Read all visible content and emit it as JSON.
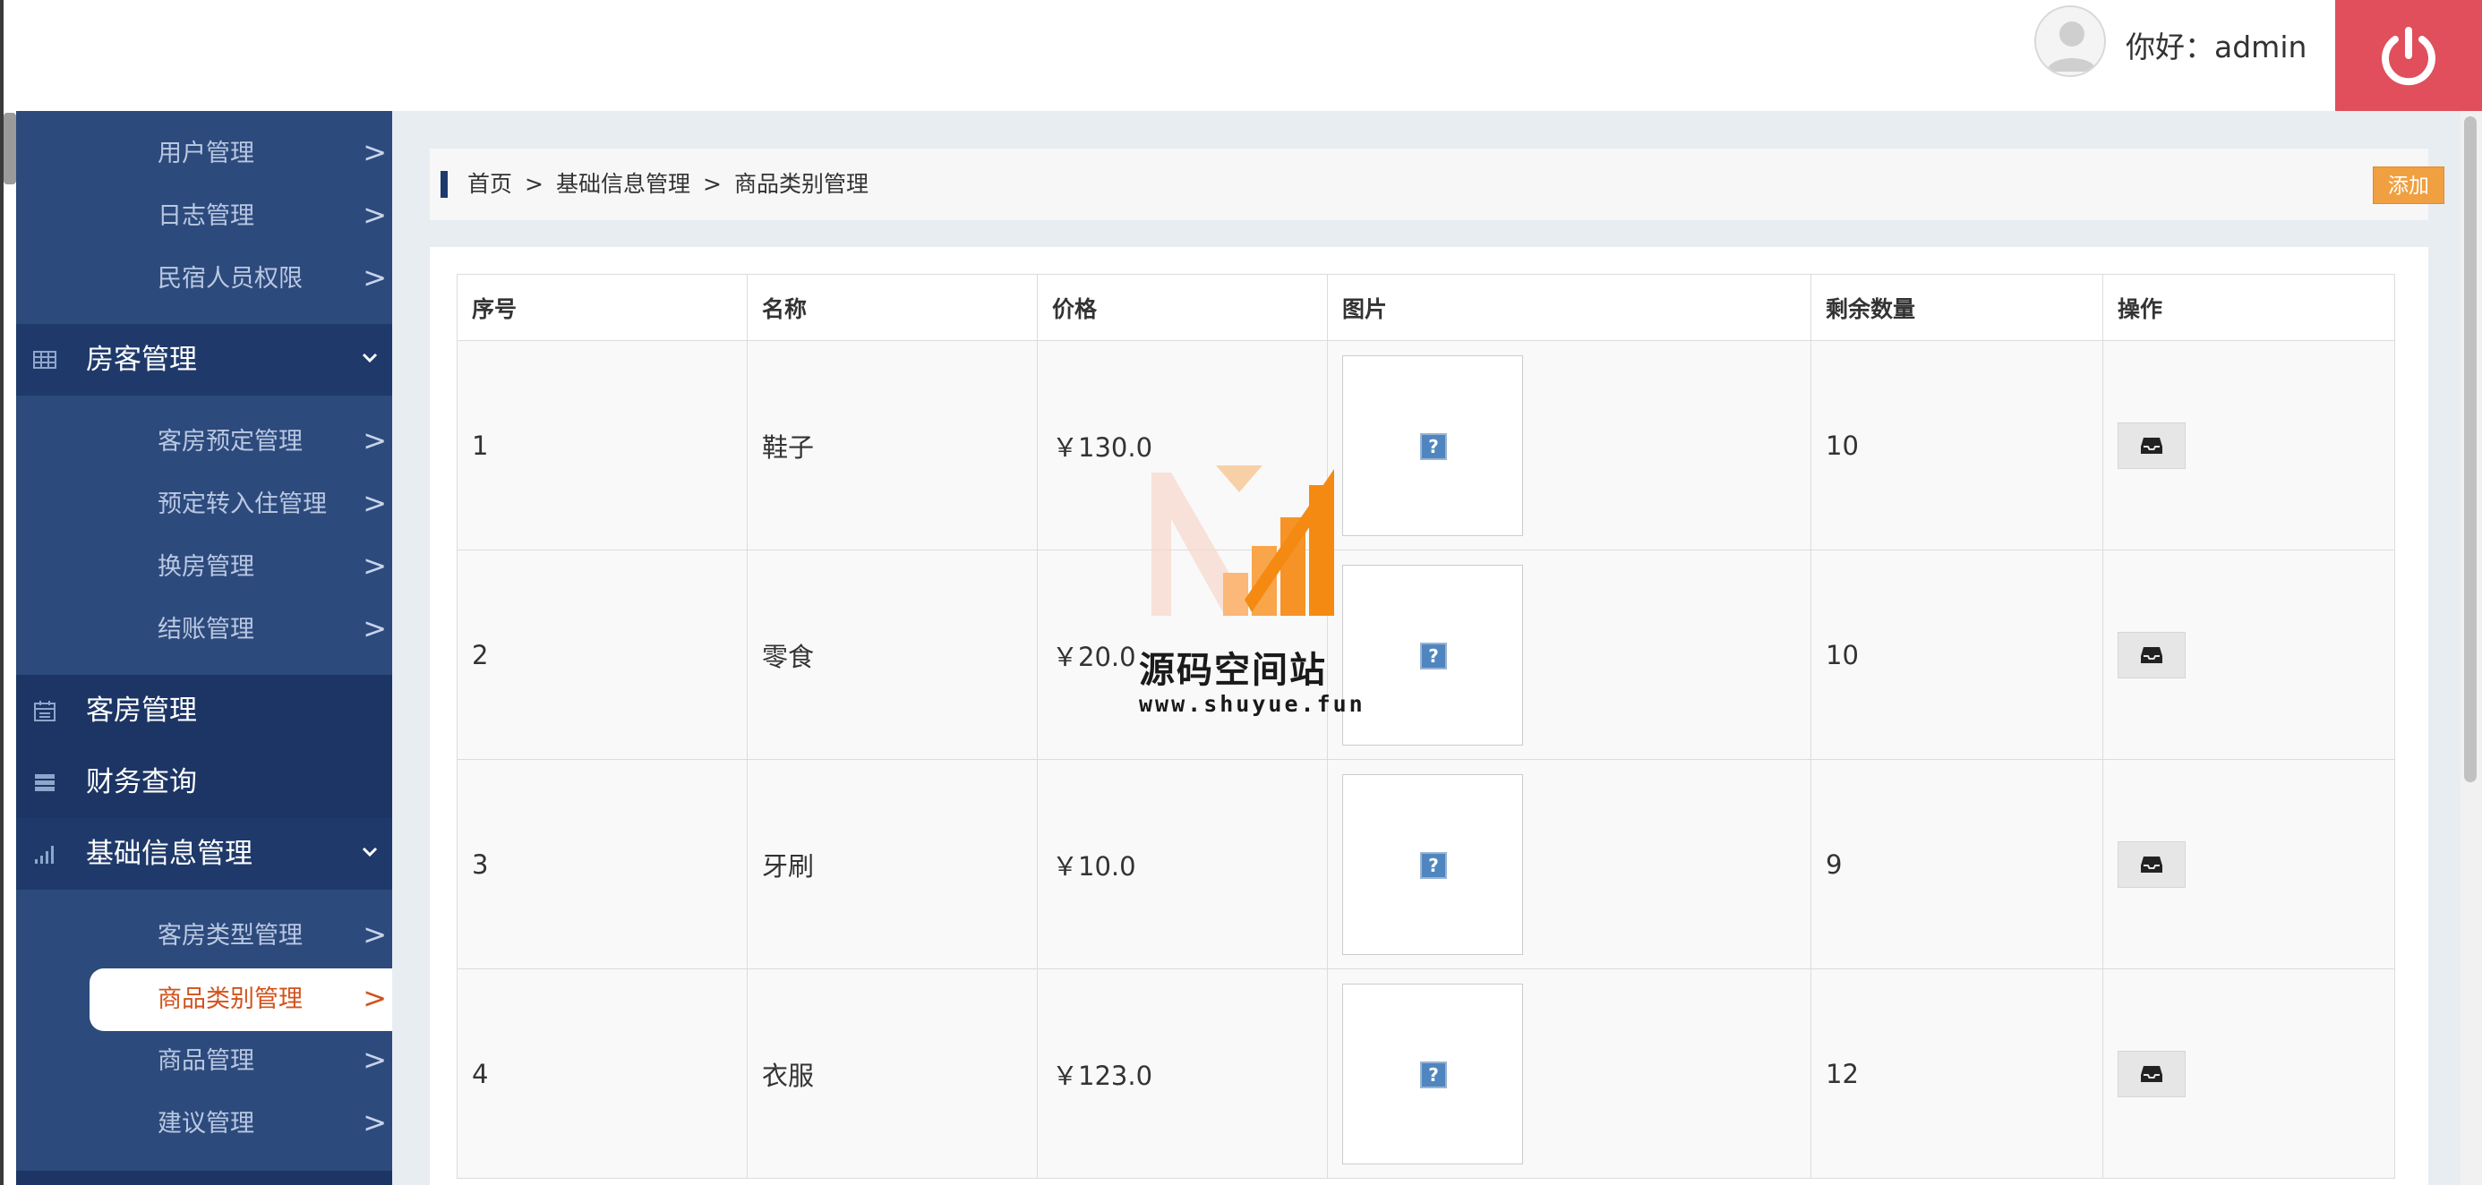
{
  "header": {
    "greeting": "你好：admin"
  },
  "sidebar": {
    "top_items": [
      {
        "label": "用户管理",
        "arrow": ">"
      },
      {
        "label": "日志管理",
        "arrow": ">"
      },
      {
        "label": "民宿人员权限",
        "arrow": ">"
      }
    ],
    "sections": {
      "guest_room": {
        "label": "房客管理",
        "items": [
          {
            "label": "客房预定管理",
            "arrow": ">"
          },
          {
            "label": "预定转入住管理",
            "arrow": ">"
          },
          {
            "label": "换房管理",
            "arrow": ">"
          },
          {
            "label": "结账管理",
            "arrow": ">"
          }
        ]
      },
      "room": {
        "label": "客房管理"
      },
      "finance": {
        "label": "财务查询"
      },
      "basic_info": {
        "label": "基础信息管理",
        "items": [
          {
            "label": "客房类型管理",
            "arrow": ">"
          },
          {
            "label": "商品类别管理",
            "arrow": ">",
            "active": true
          },
          {
            "label": "商品管理",
            "arrow": ">"
          },
          {
            "label": "建议管理",
            "arrow": ">"
          }
        ]
      }
    }
  },
  "breadcrumb": {
    "items": [
      "首页",
      "基础信息管理",
      "商品类别管理"
    ],
    "separator": ">"
  },
  "toolbar": {
    "add_label": "添加"
  },
  "table": {
    "columns": [
      "序号",
      "名称",
      "价格",
      "图片",
      "剩余数量",
      "操作"
    ],
    "rows": [
      {
        "id": "1",
        "name": "鞋子",
        "price": "￥130.0",
        "quantity": "10"
      },
      {
        "id": "2",
        "name": "零食",
        "price": "￥20.0",
        "quantity": "10"
      },
      {
        "id": "3",
        "name": "牙刷",
        "price": "￥10.0",
        "quantity": "9"
      },
      {
        "id": "4",
        "name": "衣服",
        "price": "￥123.0",
        "quantity": "12"
      }
    ],
    "image_placeholder": "?"
  },
  "watermark": {
    "title": "源码空间站",
    "url": "www.shuyue.fun"
  },
  "icons": {
    "power": "power-icon",
    "avatar": "user-avatar-icon",
    "operate": "inbox-icon",
    "broken_image": "broken-image-icon"
  },
  "colors": {
    "sidebar_bg": "#2d4a7c",
    "sidebar_section_bg": "#1f3a6a",
    "active_text": "#d2521c",
    "power_bg": "#e04f5b",
    "add_button_bg": "#f0a040"
  }
}
